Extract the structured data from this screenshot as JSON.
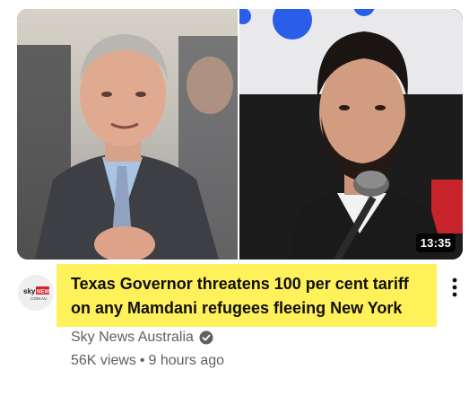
{
  "video": {
    "duration": "13:35",
    "title_line1": "Texas Governor threatens 100 per cent tariff",
    "title_line2": "on any Mamdani refugees fleeing New York",
    "highlight_color": "#fff15a"
  },
  "channel": {
    "name": "Sky News Australia",
    "avatar_logo_top": "sky",
    "avatar_logo_badge": "NEWS",
    "avatar_logo_sub": ".COM.AU",
    "verified_icon": "check-circle-icon"
  },
  "stats": {
    "views": "56K views",
    "separator": "•",
    "age": "9 hours ago"
  },
  "icons": {
    "menu": "more-vert-icon"
  }
}
